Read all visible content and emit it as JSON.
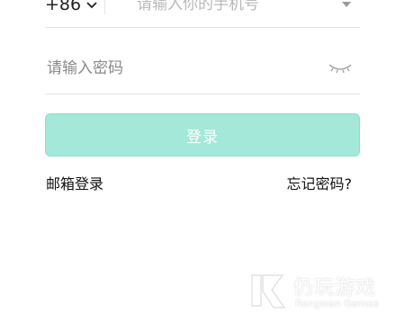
{
  "phone": {
    "country_code": "+86",
    "placeholder": "请输入你的手机号",
    "value": ""
  },
  "password": {
    "placeholder": "请输入密码",
    "value": ""
  },
  "login_label": "登录",
  "links": {
    "email_login": "邮箱登录",
    "forgot_password": "忘记密码?"
  },
  "watermark": {
    "title": "仍玩游戏",
    "subtitle": "Rengwan Games"
  },
  "icons": {
    "country_dropdown": "chevron-down-icon",
    "phone_dropdown": "caret-down-icon",
    "password_toggle": "eye-closed-icon",
    "watermark_logo": "rengwan-logo-icon"
  },
  "colors": {
    "login_button": "#a3e8d9",
    "divider": "#e3e3e3"
  }
}
